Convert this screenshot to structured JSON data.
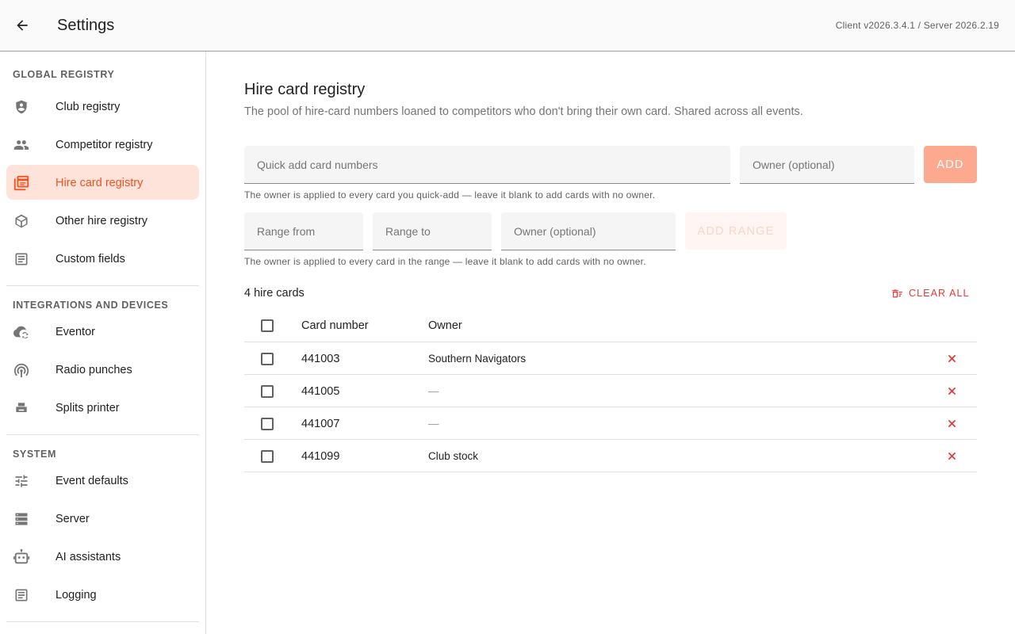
{
  "header": {
    "title": "Settings",
    "version": "Client v2026.3.4.1 / Server 2026.2.19"
  },
  "sidebar": {
    "sections": [
      {
        "title": "GLOBAL REGISTRY",
        "items": [
          {
            "label": "Club registry",
            "icon": "shield-person-icon"
          },
          {
            "label": "Competitor registry",
            "icon": "people-icon"
          },
          {
            "label": "Hire card registry",
            "icon": "cards-icon",
            "active": true
          },
          {
            "label": "Other hire registry",
            "icon": "box-icon"
          },
          {
            "label": "Custom fields",
            "icon": "form-icon"
          }
        ]
      },
      {
        "title": "INTEGRATIONS AND DEVICES",
        "items": [
          {
            "label": "Eventor",
            "icon": "cloud-sync-icon"
          },
          {
            "label": "Radio punches",
            "icon": "antenna-icon"
          },
          {
            "label": "Splits printer",
            "icon": "printer-icon"
          }
        ]
      },
      {
        "title": "SYSTEM",
        "items": [
          {
            "label": "Event defaults",
            "icon": "tune-icon"
          },
          {
            "label": "Server",
            "icon": "server-icon"
          },
          {
            "label": "AI assistants",
            "icon": "robot-icon"
          },
          {
            "label": "Logging",
            "icon": "log-icon"
          }
        ]
      }
    ]
  },
  "main": {
    "title": "Hire card registry",
    "description": "The pool of hire-card numbers loaned to competitors who don't bring their own card. Shared across all events.",
    "quick_add": {
      "card_placeholder": "Quick add card numbers",
      "owner_placeholder": "Owner (optional)",
      "add_label": "ADD",
      "hint": "The owner is applied to every card you quick-add — leave it blank to add cards with no owner."
    },
    "range_add": {
      "from_placeholder": "Range from",
      "to_placeholder": "Range to",
      "owner_placeholder": "Owner (optional)",
      "add_label": "ADD RANGE",
      "hint": "The owner is applied to every card in the range — leave it blank to add cards with no owner."
    },
    "count_label": "4 hire cards",
    "clear_all_label": "CLEAR ALL",
    "table": {
      "headers": {
        "card_number": "Card number",
        "owner": "Owner"
      },
      "rows": [
        {
          "card_number": "441003",
          "owner": "Southern Navigators"
        },
        {
          "card_number": "441005",
          "owner": "—"
        },
        {
          "card_number": "441007",
          "owner": "—"
        },
        {
          "card_number": "441099",
          "owner": "Club stock"
        }
      ]
    }
  },
  "colors": {
    "accent": "#f4511e",
    "active_bg": "#fde3d9",
    "danger": "#e53935"
  }
}
